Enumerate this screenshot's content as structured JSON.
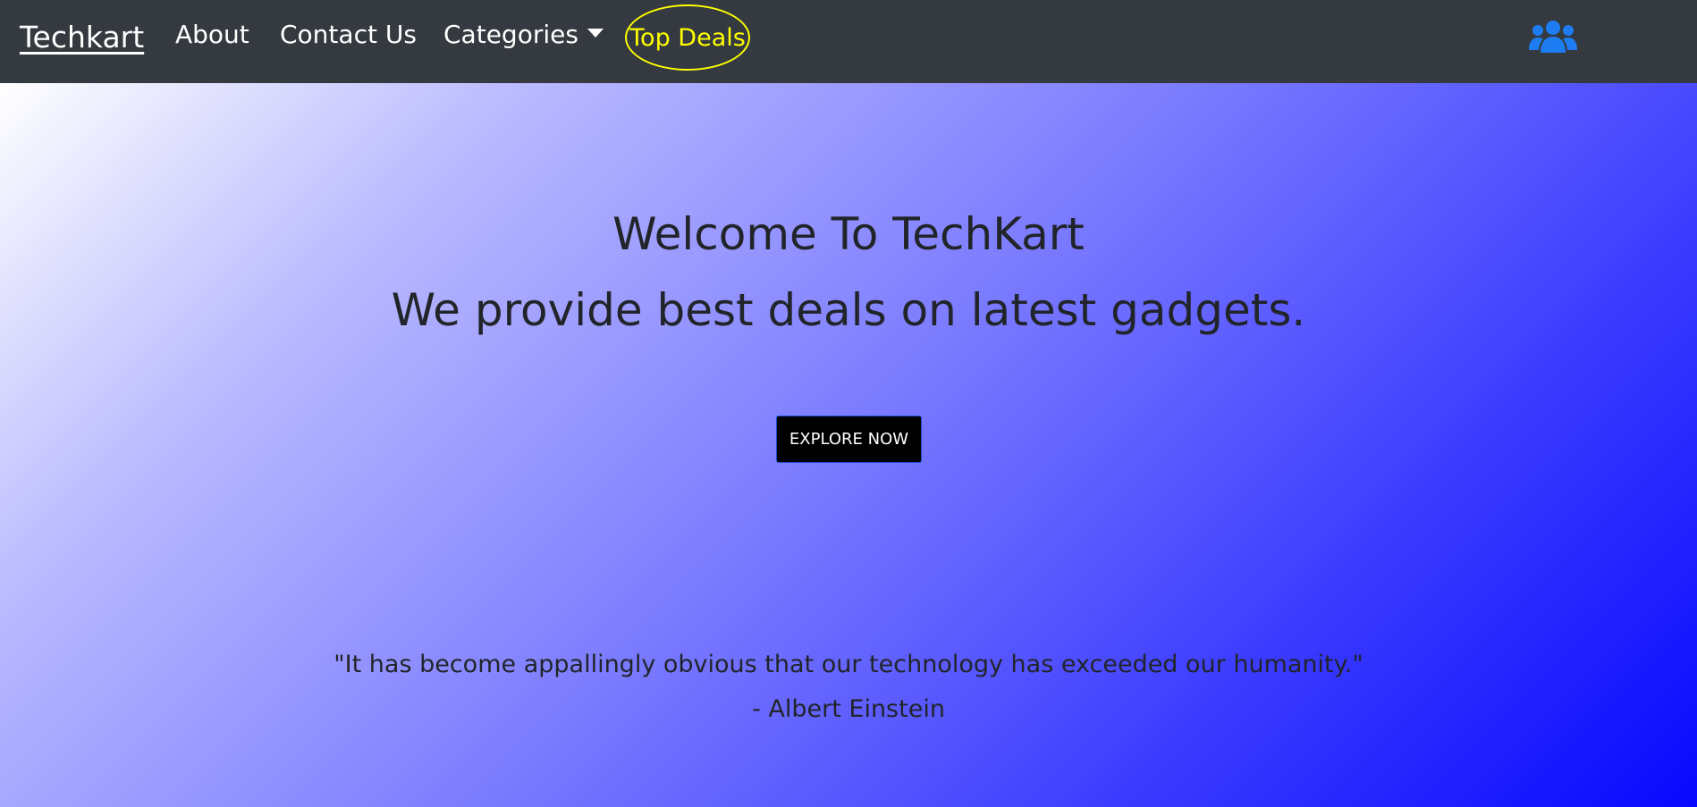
{
  "navbar": {
    "brand": "Techkart",
    "links": {
      "about": "About",
      "contact": "Contact Us",
      "categories": "Categories"
    },
    "top_deals": "Top Deals",
    "user_icon": "users-icon",
    "colors": {
      "background": "#343a40",
      "top_deals": "#ffff00",
      "user_icon": "#1d7cf2"
    }
  },
  "hero": {
    "title": "Welcome To TechKart",
    "subtitle": "We provide best deals on latest gadgets.",
    "cta_label": "EXPLORE NOW",
    "quote": {
      "text": "\"It has become appallingly obvious that our technology has exceeded our humanity.\"",
      "author": "- Albert Einstein"
    },
    "colors": {
      "gradient_start": "#ffffff",
      "gradient_end": "#0808ff",
      "button_bg": "#000000"
    }
  }
}
